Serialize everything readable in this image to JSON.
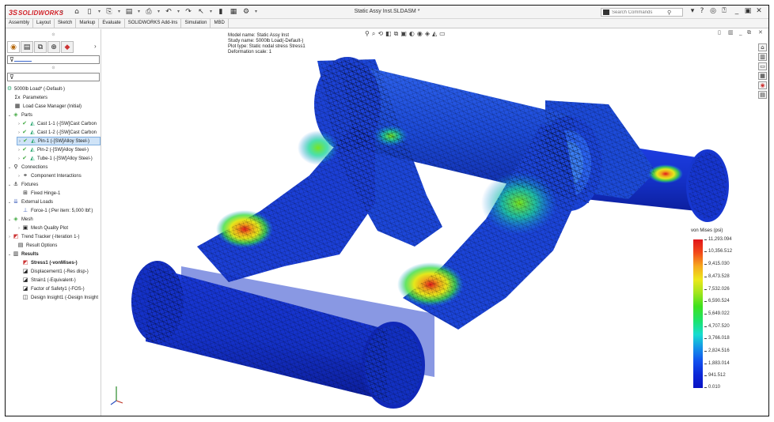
{
  "app": {
    "brand": "SOLIDWORKS",
    "brand_mark": "3S",
    "document_title": "Static Assy Inst.SLDASM *"
  },
  "search": {
    "placeholder": "Search Commands"
  },
  "tabs": [
    "Assembly",
    "Layout",
    "Sketch",
    "Markup",
    "Evaluate",
    "SOLIDWORKS Add-Ins",
    "Simulation",
    "MBD"
  ],
  "tree": {
    "root": "5000lb Load* (-Default-)",
    "items": [
      {
        "label": "Parameters"
      },
      {
        "label": "Load Case Manager (Initial)"
      },
      {
        "label": "Parts"
      },
      {
        "label": "Cast 1-1 (-[SW]Cast Carbon"
      },
      {
        "label": "Cast 1-2 (-[SW]Cast Carbon"
      },
      {
        "label": "Pin-1 (-[SW]Alloy Steel-)"
      },
      {
        "label": "Pin-2 (-[SW]Alloy Steel-)"
      },
      {
        "label": "Tube-1 (-[SW]Alloy Steel-)"
      },
      {
        "label": "Connections"
      },
      {
        "label": "Component Interactions"
      },
      {
        "label": "Fixtures"
      },
      {
        "label": "Fixed Hinge-1"
      },
      {
        "label": "External Loads"
      },
      {
        "label": "Force-1 (:Per item: 5,000 lbf:)"
      },
      {
        "label": "Mesh"
      },
      {
        "label": "Mesh Quality Plot"
      },
      {
        "label": "Trend Tracker (-Iteration 1-)"
      },
      {
        "label": "Result Options"
      },
      {
        "label": "Results"
      },
      {
        "label": "Stress1 (-vonMises-)"
      },
      {
        "label": "Displacement1 (-Res disp-)"
      },
      {
        "label": "Strain1 (-Equivalent-)"
      },
      {
        "label": "Factor of Safety1 (-FOS-)"
      },
      {
        "label": "Design Insight1 (-Design Insight"
      }
    ]
  },
  "viewport_info": {
    "model_name": "Model name: Static Assy Inst",
    "study_name": "Study name: 5000lb Load(-Default-)",
    "plot_type": "Plot type: Static nodal stress Stress1",
    "deformation_scale": "Deformation scale: 1"
  },
  "legend": {
    "title": "von Mises (psi)",
    "values": [
      "11,293.094",
      "10,356.512",
      "9,415.030",
      "8,473.528",
      "7,532.026",
      "6,590.524",
      "5,649.022",
      "4,707.520",
      "3,766.018",
      "2,824.516",
      "1,883.014",
      "941.512",
      "0.010"
    ]
  },
  "colors": {
    "accent_red": "#d2232a",
    "selection": "#cfe3f7",
    "mesh_blue": "#1530c8"
  }
}
